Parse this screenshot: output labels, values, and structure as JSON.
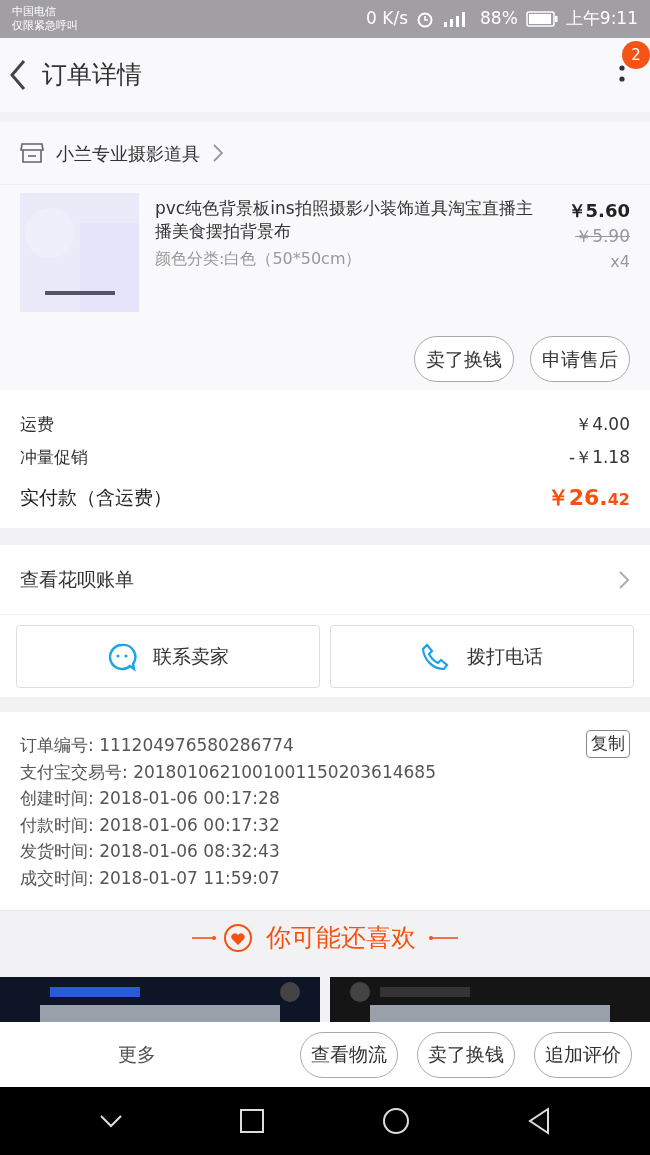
{
  "status_bar": {
    "carrier": "中国电信",
    "carrier_note": "仅限紧急呼叫",
    "speed": "0 K/s",
    "battery": "88%",
    "time": "上午9:11"
  },
  "header": {
    "title": "订单详情",
    "badge": "2"
  },
  "shop": {
    "name": "小兰专业摄影道具"
  },
  "item": {
    "title": "pvc纯色背景板ins拍照摄影小装饰道具淘宝直播主播美食摆拍背景布",
    "sku": "颜色分类:白色（50*50cm）",
    "price": "￥5.60",
    "original_price": "￥5.90",
    "quantity": "x4",
    "actions": [
      "卖了换钱",
      "申请售后"
    ]
  },
  "costs": [
    {
      "label": "运费",
      "value": "￥4.00",
      "kind": "plain"
    },
    {
      "label": "冲量促销",
      "value": "-￥1.18",
      "kind": "plain"
    },
    {
      "label": "实付款（含运费）",
      "value": "￥26.",
      "value_small": "42",
      "kind": "total"
    }
  ],
  "huabei": {
    "label": "查看花呗账单"
  },
  "contact_buttons": [
    {
      "label": "联系卖家",
      "kind": "chat"
    },
    {
      "label": "拨打电话",
      "kind": "phone"
    }
  ],
  "order_info": [
    {
      "label": "订单编号:",
      "value": "111204976580286774"
    },
    {
      "label": "支付宝交易号:",
      "value": "2018010621001001150203614685"
    },
    {
      "label": "创建时间:",
      "value": "2018-01-06 00:17:28"
    },
    {
      "label": "付款时间:",
      "value": "2018-01-06 00:17:32"
    },
    {
      "label": "发货时间:",
      "value": "2018-01-06 08:32:43"
    },
    {
      "label": "成交时间:",
      "value": "2018-01-07 11:59:07"
    }
  ],
  "copy_button": "复制",
  "recommend": {
    "title": "你可能还喜欢"
  },
  "bottom_bar": {
    "more": "更多",
    "buttons": [
      "查看物流",
      "卖了换钱",
      "追加评价"
    ]
  }
}
